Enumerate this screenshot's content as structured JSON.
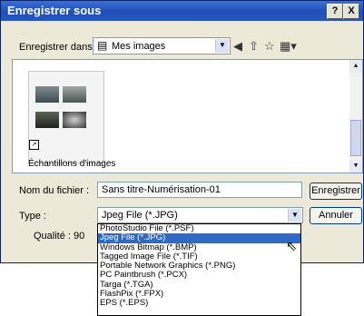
{
  "window": {
    "title": "Enregistrer sous",
    "help": "?",
    "close": "X"
  },
  "save_in": {
    "label": "Enregistrer dans :",
    "value": "Mes images"
  },
  "list": {
    "item_label": "Échantillons d'images"
  },
  "filename": {
    "label": "Nom du fichier :",
    "value": "Sans titre-Numérisation-01"
  },
  "filetype": {
    "label": "Type :",
    "value": "Jpeg File (*.JPG)"
  },
  "quality": {
    "label": "Qualité : 90"
  },
  "buttons": {
    "save": "Enregistrer",
    "cancel": "Annuler"
  },
  "type_options": [
    "PhotoStudio File (*.PSF)",
    "Jpeg File (*.JPG)",
    "Windows Bitmap (*.BMP)",
    "Tagged Image File (*.TIF)",
    "Portable Network Graphics (*.PNG)",
    "PC Paintbrush (*.PCX)",
    "Targa (*.TGA)",
    "FlashPix (*.FPX)",
    "EPS (*.EPS)"
  ],
  "selected_option_index": 1,
  "icons": [
    "folder-icon",
    "back-icon",
    "up-folder-icon",
    "new-folder-icon",
    "view-menu-icon",
    "shortcut-arrow-icon",
    "mouse-cursor-icon"
  ]
}
